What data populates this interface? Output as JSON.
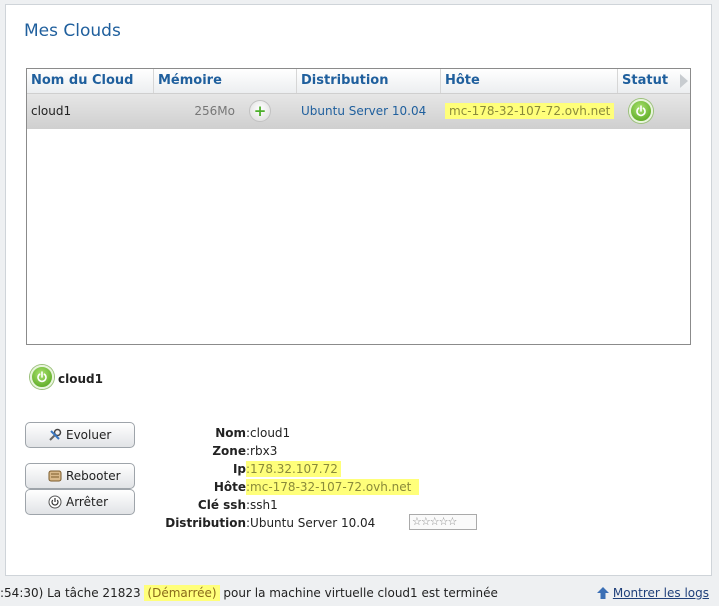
{
  "page": {
    "title": "Mes Clouds"
  },
  "grid": {
    "columns": [
      "Nom du Cloud",
      "Mémoire",
      "Distribution",
      "Hôte",
      "Statut"
    ],
    "rows": [
      {
        "name": "cloud1",
        "memory": "256Mo",
        "distribution": "Ubuntu Server 10.04",
        "host": "mc-178-32-107-72.ovh.net",
        "status": "on"
      }
    ]
  },
  "selected": {
    "name": "cloud1"
  },
  "actions": {
    "evolve": "Evoluer",
    "reboot": "Rebooter",
    "stop": "Arrêter"
  },
  "details": {
    "name_label": "Nom",
    "name_value": ":cloud1",
    "zone_label": "Zone",
    "zone_value": ":rbx3",
    "ip_label": "Ip",
    "ip_value": ":178.32.107.72",
    "host_label": "Hôte",
    "host_value": ":mc-178-32-107-72.ovh.net",
    "ssh_label": "Clé ssh",
    "ssh_value": ":ssh1",
    "dist_label": "Distribution",
    "dist_value": ":Ubuntu Server 10.04",
    "rating": "☆☆☆☆☆"
  },
  "statusbar": {
    "prefix": ":54:30) La tâche 21823 ",
    "state": "(Démarrée)",
    "suffix": " pour la machine virtuelle cloud1 est terminée",
    "logs_link": "Montrer les logs"
  },
  "colors": {
    "title": "#1f5f9d",
    "highlight": "#ffff7a",
    "power": "#5bb11f"
  }
}
